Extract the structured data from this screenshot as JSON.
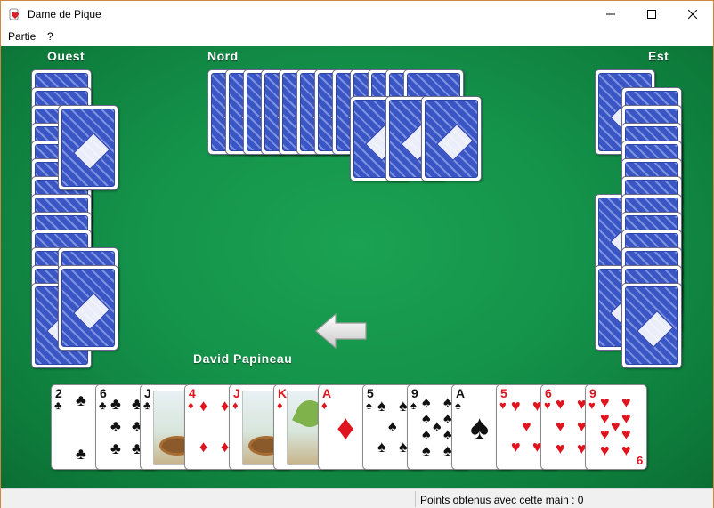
{
  "window": {
    "title": "Dame de Pique"
  },
  "menu": {
    "items": [
      "Partie",
      "?"
    ]
  },
  "players": {
    "west": "Ouest",
    "north": "Nord",
    "east": "Est",
    "south": "David Papineau"
  },
  "hand": [
    {
      "rank": "2",
      "suit": "♣",
      "color": "black"
    },
    {
      "rank": "6",
      "suit": "♣",
      "color": "black"
    },
    {
      "rank": "J",
      "suit": "♣",
      "color": "black",
      "face": true
    },
    {
      "rank": "4",
      "suit": "♦",
      "color": "red"
    },
    {
      "rank": "J",
      "suit": "♦",
      "color": "red",
      "face": true
    },
    {
      "rank": "K",
      "suit": "♦",
      "color": "red",
      "face": true
    },
    {
      "rank": "A",
      "suit": "♦",
      "color": "red"
    },
    {
      "rank": "5",
      "suit": "♠",
      "color": "black"
    },
    {
      "rank": "9",
      "suit": "♠",
      "color": "black"
    },
    {
      "rank": "A",
      "suit": "♠",
      "color": "black"
    },
    {
      "rank": "5",
      "suit": "♥",
      "color": "red"
    },
    {
      "rank": "6",
      "suit": "♥",
      "color": "red"
    },
    {
      "rank": "9",
      "suit": "♥",
      "color": "red"
    }
  ],
  "pass_direction_icon": "arrow-left-icon",
  "status": {
    "points_text": "Points obtenus avec cette main : 0"
  },
  "colors": {
    "felt": "#14924a",
    "card_back": "#3a55c4",
    "red_suit": "#e0141e"
  }
}
